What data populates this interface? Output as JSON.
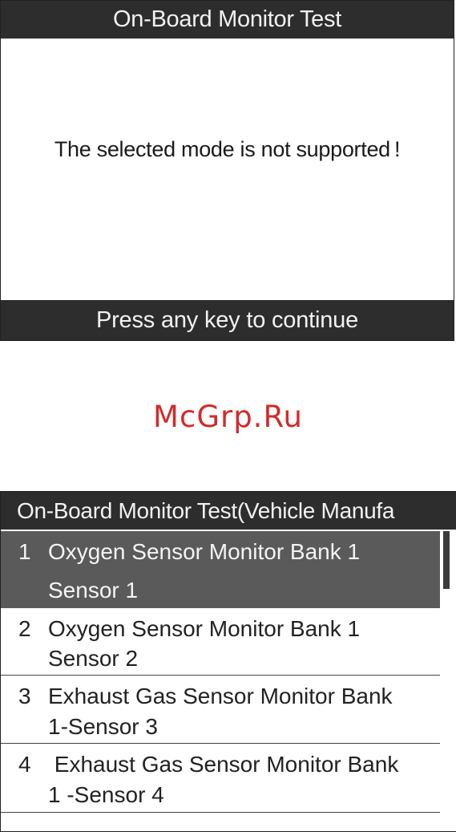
{
  "screen1": {
    "title": "On-Board Monitor Test",
    "message": "The selected mode is not supported !",
    "footer": "Press any key to continue"
  },
  "watermark": "McGrp.Ru",
  "screen2": {
    "title": "On-Board Monitor Test(Vehicle Manufa",
    "items": [
      {
        "num": "1",
        "line1": "Oxygen Sensor Monitor Bank 1",
        "line2": "Sensor 1",
        "selected": true
      },
      {
        "num": "2",
        "line1": "Oxygen Sensor Monitor Bank 1",
        "line2": "Sensor 2",
        "selected": false
      },
      {
        "num": "3",
        "line1": "Exhaust Gas Sensor Monitor Bank",
        "line2": "1-Sensor 3",
        "selected": false
      },
      {
        "num": "4",
        "line1": " Exhaust Gas Sensor Monitor Bank",
        "line2": "1 -Sensor 4",
        "selected": false
      }
    ]
  }
}
